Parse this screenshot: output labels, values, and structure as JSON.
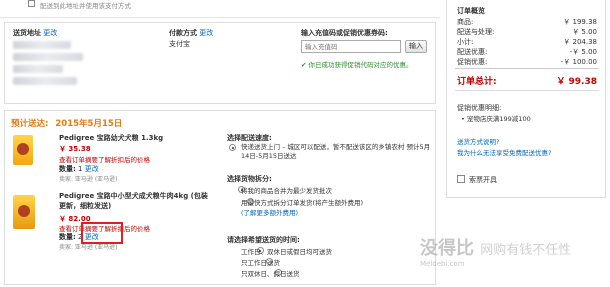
{
  "top_left_text": "配送到此地址并使用该支付方式",
  "shipping": {
    "address_label": "送货地址",
    "address_edit": "更改"
  },
  "payment": {
    "label": "付款方式",
    "edit": "更改",
    "method": "支付宝"
  },
  "coupon": {
    "title": "输入充值码或促销优惠券码:",
    "placeholder": "输入充值码",
    "button": "输入",
    "success": "你已成功获得促销代码对应的优惠。"
  },
  "order": {
    "estimate_label": "预计送达:",
    "estimate_date": "2015年5月15日",
    "items": [
      {
        "name": "Pedigree 宝路幼犬犬粮 1.3kg",
        "price": "￥ 35.38",
        "coupon_note": "查看订单摘要了解折扣后的价格",
        "qty_label": "数量:",
        "qty": "1",
        "qty_edit": "更改",
        "seller": "卖家: 亚马逊 (亚马逊)"
      },
      {
        "name": "Pedigree 宝路中小型犬成犬粮牛肉4kg (包装更新，细粒发送)",
        "price": "￥ 82.00",
        "coupon_note": "查看订单摘要了解折扣后的价格",
        "qty_label": "数量:",
        "qty": "2",
        "qty_edit": "更改",
        "seller": "卖家: 亚马逊 (亚马逊)"
      }
    ]
  },
  "delivery_speed": {
    "title": "选择配送速度:",
    "option": "快递送货上门 – 城区可以配送，暂不配送该区的乡镇农村 预计5月14日-5月15日送达"
  },
  "shipment_grouping": {
    "title": "选择货物拆分:",
    "options": [
      "将我的商品合并为最少发货批次",
      "用最快方式拆分订单发货(将产生额外费用)"
    ],
    "fee_link": "(了解更多额外费用)"
  },
  "delivery_time": {
    "title": "请选择希望送货的时间:",
    "options": [
      "工作日、双休日或假日均可送货",
      "只工作日送货",
      "只双休日、假日送货"
    ]
  },
  "summary": {
    "title": "订单概览",
    "rows": [
      {
        "label": "商品:",
        "value": "￥ 199.38"
      },
      {
        "label": "配送与处理:",
        "value": "￥ 5.00"
      },
      {
        "label": "小计:",
        "value": "￥ 204.38"
      },
      {
        "label": "配送优惠:",
        "value": "-￥ 5.00"
      },
      {
        "label": "促销优惠:",
        "value": "-￥ 100.00"
      }
    ],
    "total_label": "订单总计:",
    "total_value": "￥ 99.38",
    "promo_title": "促销优惠明细:",
    "promo_item": "• 宠物店庆满199减100",
    "links": [
      "送货方式说明?",
      "我为什么无法享受免费配送优惠?"
    ],
    "invoice_label": "索票开具"
  },
  "watermark": {
    "cn": "没得比",
    "en": "Meidebi.com",
    "slogan": "网购有钱不任性"
  }
}
